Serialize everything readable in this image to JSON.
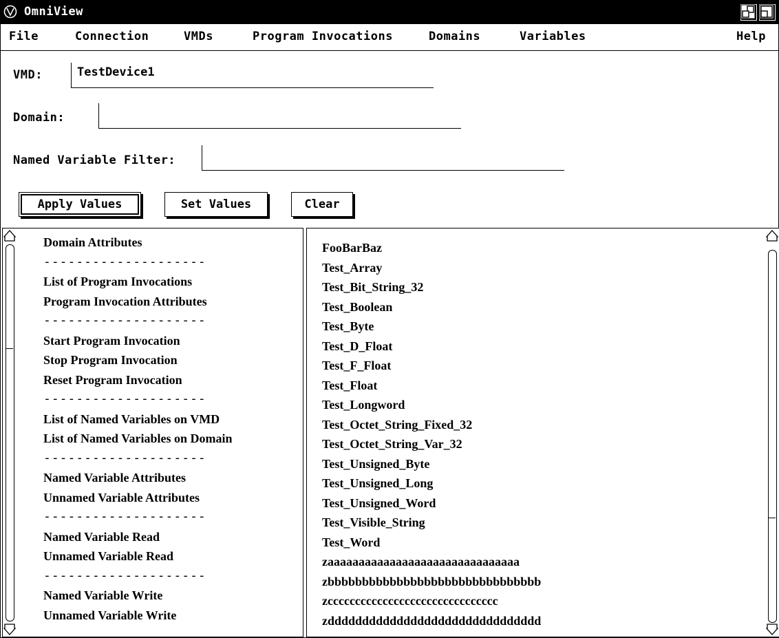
{
  "window": {
    "title": "OmniView"
  },
  "menubar": {
    "file": "File",
    "connection": "Connection",
    "vmds": "VMDs",
    "program_invocations": "Program Invocations",
    "domains": "Domains",
    "variables": "Variables",
    "help": "Help"
  },
  "form": {
    "vmd_label": "VMD:",
    "vmd_value": "TestDevice1",
    "domain_label": "Domain:",
    "domain_value": "",
    "filter_label": "Named Variable Filter:",
    "filter_value": ""
  },
  "buttons": {
    "apply": "Apply Values",
    "set": "Set Values",
    "clear": "Clear"
  },
  "operations": [
    "Domain Attributes",
    "--------------------",
    "List of Program Invocations",
    "Program Invocation Attributes",
    "--------------------",
    "Start Program Invocation",
    "Stop Program Invocation",
    "Reset Program Invocation",
    "--------------------",
    "List of Named Variables on VMD",
    "List of Named Variables on Domain",
    "--------------------",
    "Named Variable Attributes",
    "Unnamed Variable Attributes",
    "--------------------",
    "Named Variable Read",
    "Unnamed Variable Read",
    "--------------------",
    "Named Variable Write",
    "Unnamed Variable Write"
  ],
  "variables": [
    "FooBarBaz",
    "Test_Array",
    "Test_Bit_String_32",
    "Test_Boolean",
    "Test_Byte",
    "Test_D_Float",
    "Test_F_Float",
    "Test_Float",
    "Test_Longword",
    "Test_Octet_String_Fixed_32",
    "Test_Octet_String_Var_32",
    "Test_Unsigned_Byte",
    "Test_Unsigned_Long",
    "Test_Unsigned_Word",
    "Test_Visible_String",
    "Test_Word",
    "zaaaaaaaaaaaaaaaaaaaaaaaaaaaaaaa",
    "zbbbbbbbbbbbbbbbbbbbbbbbbbbbbbbb",
    "zccccccccccccccccccccccccccccccc",
    "zddddddddddddddddddddddddddddddd"
  ],
  "scroll": {
    "left_position": 0.5,
    "right_position": 0.0
  }
}
